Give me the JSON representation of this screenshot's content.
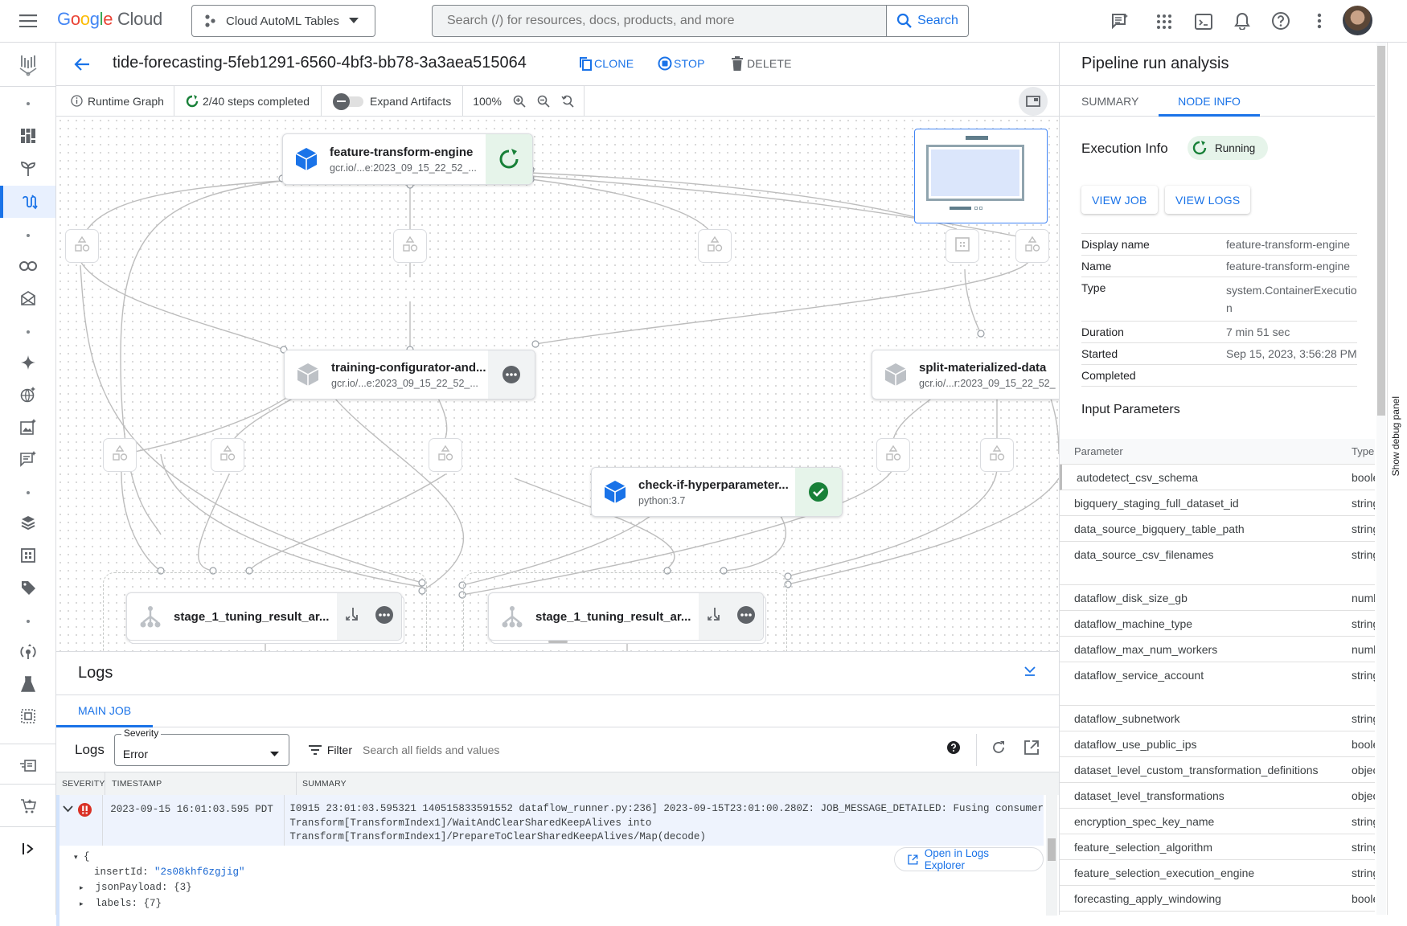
{
  "topbar": {
    "menu_icon": "hamburger-menu-icon",
    "logo_google": "Google",
    "logo_cloud": "Cloud",
    "project": "Cloud AutoML Tables",
    "search_placeholder": "Search (/) for resources, docs, products, and more",
    "search_button": "Search",
    "icons": [
      "gemini-chat-icon",
      "apps-grid-icon",
      "cloud-shell-icon",
      "notifications-icon",
      "help-icon",
      "more-vert-icon",
      "user-avatar"
    ]
  },
  "sidebar": {
    "logo_icon": "vertex-ai-icon",
    "items": [
      {
        "icon": "dot",
        "active": false
      },
      {
        "icon": "dashboard-icon",
        "active": false
      },
      {
        "icon": "model-garden-icon",
        "active": false
      },
      {
        "icon": "pipelines-icon",
        "active": true
      },
      {
        "icon": "dot",
        "active": false
      },
      {
        "icon": "colab-icon",
        "active": false
      },
      {
        "icon": "workbench-icon",
        "active": false
      },
      {
        "icon": "dot",
        "active": false
      },
      {
        "icon": "sparkle-icon",
        "active": false
      },
      {
        "icon": "vision-icon",
        "active": false
      },
      {
        "icon": "image-sparkle-icon",
        "active": false
      },
      {
        "icon": "text-sparkle-icon",
        "active": false
      },
      {
        "icon": "dot",
        "active": false
      },
      {
        "icon": "datasets-icon",
        "active": false
      },
      {
        "icon": "feature-store-icon",
        "active": false
      },
      {
        "icon": "labeling-tag-icon",
        "active": false
      },
      {
        "icon": "dot",
        "active": false
      },
      {
        "icon": "training-icon",
        "active": false
      },
      {
        "icon": "experiments-flask-icon",
        "active": false
      },
      {
        "icon": "metadata-icon",
        "active": false
      }
    ],
    "bottom_icons": [
      "release-notes-icon",
      "marketplace-icon",
      "expand-sidebar-icon"
    ]
  },
  "header": {
    "back_icon": "arrow-back-icon",
    "title": "tide-forecasting-5feb1291-6560-4bf3-bb78-3a3aea515064",
    "clone": "CLONE",
    "stop": "STOP",
    "delete": "DELETE"
  },
  "toolbar": {
    "runtime_graph": "Runtime Graph",
    "steps": "2/40 steps completed",
    "expand_artifacts": "Expand Artifacts",
    "expand_artifacts_on": false,
    "zoom": "100%"
  },
  "graph": {
    "nodes": [
      {
        "title": "feature-transform-engine",
        "subtitle": "gcr.io/...e:2023_09_15_22_52_...",
        "status": "running",
        "active": true
      },
      {
        "title": "training-configurator-and...",
        "subtitle": "gcr.io/...e:2023_09_15_22_52_...",
        "status": "pending",
        "active": false
      },
      {
        "title": "split-materialized-data",
        "subtitle": "gcr.io/...r:2023_09_15_22_52_",
        "status": "none",
        "active": false
      },
      {
        "title": "check-if-hyperparameter...",
        "subtitle": "python:3.7",
        "status": "succeeded",
        "active": true
      },
      {
        "title": "stage_1_tuning_result_ar...",
        "subtitle": "",
        "status": "pending",
        "active": false
      },
      {
        "title": "stage_1_tuning_result_ar...",
        "subtitle": "",
        "status": "pending",
        "active": false
      }
    ]
  },
  "logs": {
    "title": "Logs",
    "tabs": [
      {
        "label": "MAIN JOB",
        "active": true
      }
    ],
    "filter_label": "Logs",
    "severity_label": "Severity",
    "severity_value": "Error",
    "filter_button": "Filter",
    "search_placeholder": "Search all fields and values",
    "columns": [
      "SEVERITY",
      "TIMESTAMP",
      "SUMMARY"
    ],
    "rows": [
      {
        "severity": "error",
        "timestamp": "2023-09-15 16:01:03.595 PDT",
        "summary_lines": [
          "I0915 23:01:03.595321 140515833591552 dataflow_runner.py:236] 2023-09-15T23:01:00.280Z: JOB_MESSAGE_DETAILED: Fusing consumer",
          "Transform[TransformIndex1]/WaitAndClearSharedKeepAlives into",
          "Transform[TransformIndex1]/PrepareToClearSharedKeepAlives/Map(decode)"
        ]
      }
    ],
    "expanded": {
      "open_brace": "{",
      "insert_id_key": "insertId:",
      "insert_id_value": "\"2s08khf6zgjig\"",
      "json_payload": "jsonPayload: {3}",
      "labels": "labels: {7}",
      "open_explorer": "Open in Logs Explorer"
    }
  },
  "rpanel": {
    "title": "Pipeline run analysis",
    "tabs": [
      {
        "label": "SUMMARY",
        "active": false
      },
      {
        "label": "NODE INFO",
        "active": true
      }
    ],
    "exec_title": "Execution Info",
    "status": "Running",
    "view_job": "VIEW JOB",
    "view_logs": "VIEW LOGS",
    "info": [
      {
        "k": "Display name",
        "v": "feature-transform-engine"
      },
      {
        "k": "Name",
        "v": "feature-transform-engine"
      },
      {
        "k": "Type",
        "v": "system.ContainerExecution"
      },
      {
        "k": "Duration",
        "v": "7 min 51 sec"
      },
      {
        "k": "Started",
        "v": "Sep 15, 2023, 3:56:28 PM"
      },
      {
        "k": "Completed",
        "v": ""
      }
    ],
    "input_title": "Input Parameters",
    "param_headers": [
      "Parameter",
      "Type"
    ],
    "params": [
      {
        "name": "autodetect_csv_schema",
        "type": "boolean",
        "tall": false
      },
      {
        "name": "bigquery_staging_full_dataset_id",
        "type": "string",
        "tall": false
      },
      {
        "name": "data_source_bigquery_table_path",
        "type": "string",
        "tall": false
      },
      {
        "name": "data_source_csv_filenames",
        "type": "string",
        "tall": true
      },
      {
        "name": "dataflow_disk_size_gb",
        "type": "number",
        "tall": false
      },
      {
        "name": "dataflow_machine_type",
        "type": "string",
        "tall": false
      },
      {
        "name": "dataflow_max_num_workers",
        "type": "number",
        "tall": false
      },
      {
        "name": "dataflow_service_account",
        "type": "string",
        "tall": true
      },
      {
        "name": "dataflow_subnetwork",
        "type": "string",
        "tall": false
      },
      {
        "name": "dataflow_use_public_ips",
        "type": "boolean",
        "tall": false
      },
      {
        "name": "dataset_level_custom_transformation_definitions",
        "type": "object",
        "tall": false
      },
      {
        "name": "dataset_level_transformations",
        "type": "object",
        "tall": false
      },
      {
        "name": "encryption_spec_key_name",
        "type": "string",
        "tall": false
      },
      {
        "name": "feature_selection_algorithm",
        "type": "string",
        "tall": false
      },
      {
        "name": "feature_selection_execution_engine",
        "type": "string",
        "tall": false
      },
      {
        "name": "forecasting_apply_windowing",
        "type": "boolean",
        "tall": false
      }
    ]
  },
  "debug_panel": "Show debug panel",
  "colors": {
    "accent": "#1a73e8",
    "success": "#188038",
    "error": "#d93025",
    "running_bg": "#e6f4ea"
  }
}
